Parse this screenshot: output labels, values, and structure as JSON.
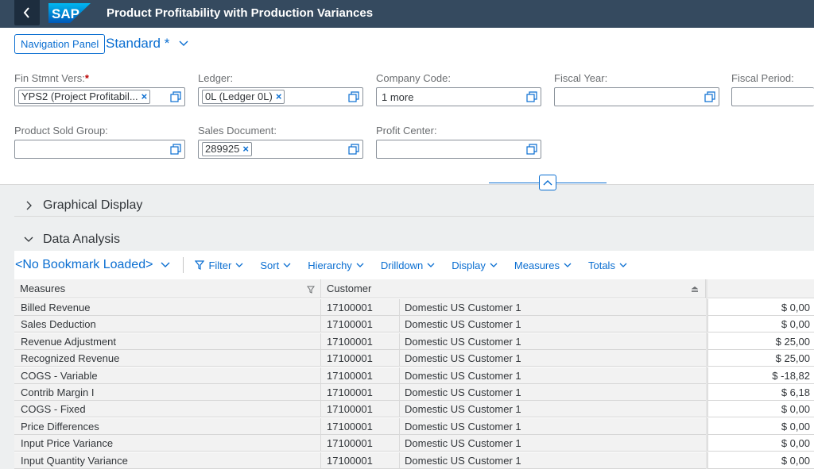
{
  "shell": {
    "title": "Product Profitability with Production Variances",
    "logo_text": "SAP"
  },
  "variant": {
    "nav_panel_label": "Navigation Panel",
    "name": "Standard *"
  },
  "filters": {
    "fin_stmt_vers": {
      "label": "Fin Stmnt Vers:",
      "required": "*",
      "token": "YPS2 (Project Profitabil..."
    },
    "ledger": {
      "label": "Ledger:",
      "token": "0L (Ledger 0L)"
    },
    "company_code": {
      "label": "Company Code:",
      "value": "1 more"
    },
    "fiscal_year": {
      "label": "Fiscal Year:"
    },
    "fiscal_period": {
      "label": "Fiscal Period:"
    },
    "product_sold_group": {
      "label": "Product Sold Group:"
    },
    "sales_document": {
      "label": "Sales Document:",
      "token": "289925"
    },
    "profit_center": {
      "label": "Profit Center:"
    }
  },
  "sections": {
    "graphical": "Graphical Display",
    "analysis": "Data Analysis"
  },
  "toolbar": {
    "bookmark": "<No Bookmark Loaded>",
    "items": [
      "Filter",
      "Sort",
      "Hierarchy",
      "Drilldown",
      "Display",
      "Measures",
      "Totals"
    ]
  },
  "table": {
    "headers": {
      "measures": "Measures",
      "customer": "Customer"
    },
    "rows": [
      {
        "measure": "Billed Revenue",
        "customer_id": "17100001",
        "customer_name": "Domestic US Customer 1",
        "value": "$ 0,00"
      },
      {
        "measure": "Sales Deduction",
        "customer_id": "17100001",
        "customer_name": "Domestic US Customer 1",
        "value": "$ 0,00"
      },
      {
        "measure": "Revenue Adjustment",
        "customer_id": "17100001",
        "customer_name": "Domestic US Customer 1",
        "value": "$ 25,00"
      },
      {
        "measure": "Recognized Revenue",
        "customer_id": "17100001",
        "customer_name": "Domestic US Customer 1",
        "value": "$ 25,00"
      },
      {
        "measure": "COGS - Variable",
        "customer_id": "17100001",
        "customer_name": "Domestic US Customer 1",
        "value": "$ -18,82"
      },
      {
        "measure": "Contrib Margin I",
        "customer_id": "17100001",
        "customer_name": "Domestic US Customer 1",
        "value": "$ 6,18"
      },
      {
        "measure": "COGS - Fixed",
        "customer_id": "17100001",
        "customer_name": "Domestic US Customer 1",
        "value": "$ 0,00"
      },
      {
        "measure": "Price Differences",
        "customer_id": "17100001",
        "customer_name": "Domestic US Customer 1",
        "value": "$ 0,00"
      },
      {
        "measure": "Input Price Variance",
        "customer_id": "17100001",
        "customer_name": "Domestic US Customer 1",
        "value": "$ 0,00"
      },
      {
        "measure": "Input Quantity Variance",
        "customer_id": "17100001",
        "customer_name": "Domestic US Customer 1",
        "value": "$ 0,00"
      }
    ]
  },
  "colors": {
    "shell": "#354a5f",
    "accent": "#0a6ed1",
    "required": "#bb0000"
  }
}
